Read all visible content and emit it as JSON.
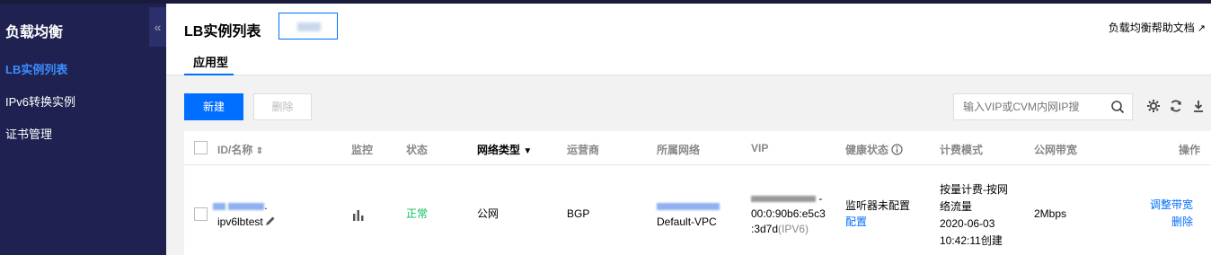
{
  "sidebar": {
    "title": "负载均衡",
    "collapse_icon": "«",
    "items": [
      {
        "label": "LB实例列表",
        "active": true
      },
      {
        "label": "IPv6转换实例",
        "active": false
      },
      {
        "label": "证书管理",
        "active": false
      }
    ]
  },
  "header": {
    "title": "LB实例列表",
    "help_link": "负载均衡帮助文档",
    "help_icon": "↗",
    "tabs": [
      {
        "label": "应用型"
      }
    ]
  },
  "toolbar": {
    "new_label": "新建",
    "delete_label": "删除",
    "search_placeholder": "输入VIP或CVM内网IP搜"
  },
  "table": {
    "columns": [
      "ID/名称",
      "监控",
      "状态",
      "网络类型",
      "运营商",
      "所属网络",
      "VIP",
      "健康状态",
      "计费模式",
      "公网带宽",
      "操作"
    ],
    "rows": [
      {
        "name": "ipv6lbtest",
        "status": "正常",
        "network_type": "公网",
        "isp": "BGP",
        "vpc": "Default-VPC",
        "vip_line1": "00:0:90b6:e5c3",
        "vip_line2": ":3d7d",
        "vip_tag": "(IPV6)",
        "health": "监听器未配置",
        "health_link": "配置",
        "billing_line1": "按量计费-按网",
        "billing_line2": "络流量",
        "billing_line3": "2020-06-03",
        "billing_line4": "10:42:11创建",
        "bandwidth": "2Mbps",
        "action1": "调整带宽",
        "action2": "删除"
      }
    ]
  },
  "colors": {
    "sidebar_bg": "#1f2251",
    "accent": "#006eff",
    "status_ok": "#0abf5b"
  }
}
